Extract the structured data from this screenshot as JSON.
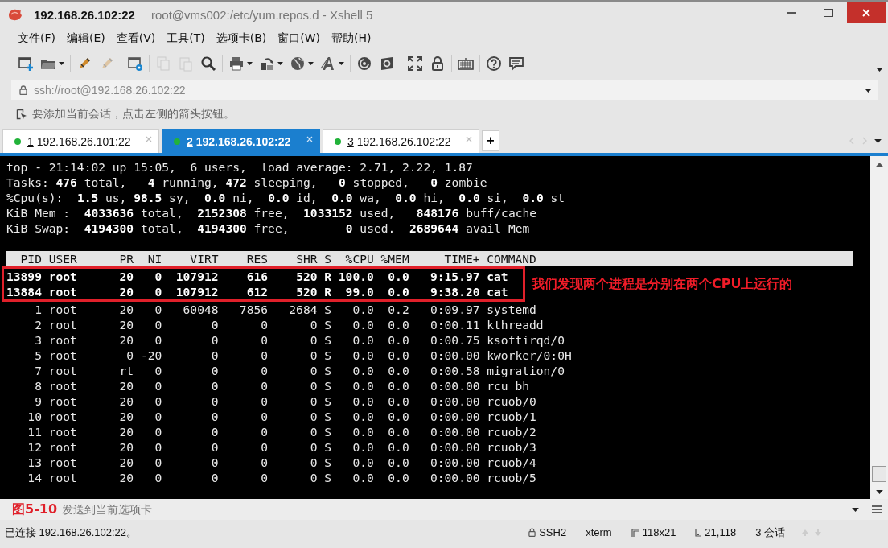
{
  "window": {
    "title_host": "192.168.26.102:22",
    "title_path": "root@vms002:/etc/yum.repos.d - Xshell 5"
  },
  "menu": [
    "文件(F)",
    "编辑(E)",
    "查看(V)",
    "工具(T)",
    "选项卡(B)",
    "窗口(W)",
    "帮助(H)"
  ],
  "toolbar": [
    {
      "kind": "new",
      "disabled": false,
      "dropdown": false
    },
    {
      "kind": "folder",
      "disabled": false,
      "dropdown": true
    },
    {
      "kind": "separator"
    },
    {
      "kind": "connect",
      "disabled": false,
      "dropdown": false
    },
    {
      "kind": "connect",
      "disabled": true,
      "dropdown": false
    },
    {
      "kind": "separator"
    },
    {
      "kind": "properties",
      "disabled": false,
      "dropdown": false
    },
    {
      "kind": "separator"
    },
    {
      "kind": "copy",
      "disabled": true,
      "dropdown": false
    },
    {
      "kind": "paste",
      "disabled": true,
      "dropdown": false
    },
    {
      "kind": "search",
      "disabled": false,
      "dropdown": false
    },
    {
      "kind": "separator"
    },
    {
      "kind": "print",
      "disabled": false,
      "dropdown": true
    },
    {
      "kind": "transfer",
      "disabled": false,
      "dropdown": true
    },
    {
      "kind": "globe",
      "disabled": false,
      "dropdown": true
    },
    {
      "kind": "font",
      "disabled": false,
      "dropdown": true
    },
    {
      "kind": "separator"
    },
    {
      "kind": "shell",
      "disabled": false,
      "dropdown": false
    },
    {
      "kind": "ftp",
      "disabled": false,
      "dropdown": false
    },
    {
      "kind": "separator"
    },
    {
      "kind": "fullscreen",
      "disabled": false,
      "dropdown": false
    },
    {
      "kind": "lock",
      "disabled": false,
      "dropdown": false
    },
    {
      "kind": "separator"
    },
    {
      "kind": "keyboard",
      "disabled": false,
      "dropdown": false
    },
    {
      "kind": "separator"
    },
    {
      "kind": "help",
      "disabled": false,
      "dropdown": false
    },
    {
      "kind": "chat",
      "disabled": false,
      "dropdown": false
    }
  ],
  "address": {
    "value": "ssh://root@192.168.26.102:22"
  },
  "hint": {
    "text": "要添加当前会话，点击左侧的箭头按钮。"
  },
  "tabs": [
    {
      "number": "1",
      "label": "192.168.26.101:22",
      "selected": false
    },
    {
      "number": "2",
      "label": "192.168.26.102:22",
      "selected": true
    },
    {
      "number": "3",
      "label": "192.168.26.102:22",
      "selected": false
    }
  ],
  "add_tab": "+",
  "terminal": {
    "summary_lines": [
      "top - 21:14:02 up 15:05,  6 users,  load average: 2.71, 2.22, 1.87",
      "Tasks: **476** total,   **4** running, **472** sleeping,   **0** stopped,   **0** zombie",
      "%Cpu(s):  **1.5** us, **98.5** sy,  **0.0** ni,  **0.0** id,  **0.0** wa,  **0.0** hi,  **0.0** si,  **0.0** st",
      "KiB Mem :  **4033636** total,  **2152308** free,  **1033152** used,   **848176** buff/cache",
      "KiB Swap:  **4194300** total,  **4194300** free,        **0** used.  **2689644** avail Mem"
    ],
    "columns": [
      "PID",
      "USER",
      "PR",
      "NI",
      "VIRT",
      "RES",
      "SHR",
      "S",
      "%CPU",
      "%MEM",
      "TIME+",
      "COMMAND"
    ],
    "rows": [
      {
        "bold": true,
        "boxed": true,
        "cells": [
          "13899",
          "root",
          "20",
          "0",
          "107912",
          "616",
          "520",
          "R",
          "100.0",
          "0.0",
          "9:15.97",
          "cat"
        ]
      },
      {
        "bold": true,
        "boxed": true,
        "cells": [
          "13884",
          "root",
          "20",
          "0",
          "107912",
          "612",
          "520",
          "R",
          "99.0",
          "0.0",
          "9:38.20",
          "cat"
        ]
      },
      {
        "bold": false,
        "boxed": false,
        "cells": [
          "1",
          "root",
          "20",
          "0",
          "60048",
          "7856",
          "2684",
          "S",
          "0.0",
          "0.2",
          "0:09.97",
          "systemd"
        ]
      },
      {
        "bold": false,
        "boxed": false,
        "cells": [
          "2",
          "root",
          "20",
          "0",
          "0",
          "0",
          "0",
          "S",
          "0.0",
          "0.0",
          "0:00.11",
          "kthreadd"
        ]
      },
      {
        "bold": false,
        "boxed": false,
        "cells": [
          "3",
          "root",
          "20",
          "0",
          "0",
          "0",
          "0",
          "S",
          "0.0",
          "0.0",
          "0:00.75",
          "ksoftirqd/0"
        ]
      },
      {
        "bold": false,
        "boxed": false,
        "cells": [
          "5",
          "root",
          "0",
          "-20",
          "0",
          "0",
          "0",
          "S",
          "0.0",
          "0.0",
          "0:00.00",
          "kworker/0:0H"
        ]
      },
      {
        "bold": false,
        "boxed": false,
        "cells": [
          "7",
          "root",
          "rt",
          "0",
          "0",
          "0",
          "0",
          "S",
          "0.0",
          "0.0",
          "0:00.58",
          "migration/0"
        ]
      },
      {
        "bold": false,
        "boxed": false,
        "cells": [
          "8",
          "root",
          "20",
          "0",
          "0",
          "0",
          "0",
          "S",
          "0.0",
          "0.0",
          "0:00.00",
          "rcu_bh"
        ]
      },
      {
        "bold": false,
        "boxed": false,
        "cells": [
          "9",
          "root",
          "20",
          "0",
          "0",
          "0",
          "0",
          "S",
          "0.0",
          "0.0",
          "0:00.00",
          "rcuob/0"
        ]
      },
      {
        "bold": false,
        "boxed": false,
        "cells": [
          "10",
          "root",
          "20",
          "0",
          "0",
          "0",
          "0",
          "S",
          "0.0",
          "0.0",
          "0:00.00",
          "rcuob/1"
        ]
      },
      {
        "bold": false,
        "boxed": false,
        "cells": [
          "11",
          "root",
          "20",
          "0",
          "0",
          "0",
          "0",
          "S",
          "0.0",
          "0.0",
          "0:00.00",
          "rcuob/2"
        ]
      },
      {
        "bold": false,
        "boxed": false,
        "cells": [
          "12",
          "root",
          "20",
          "0",
          "0",
          "0",
          "0",
          "S",
          "0.0",
          "0.0",
          "0:00.00",
          "rcuob/3"
        ]
      },
      {
        "bold": false,
        "boxed": false,
        "cells": [
          "13",
          "root",
          "20",
          "0",
          "0",
          "0",
          "0",
          "S",
          "0.0",
          "0.0",
          "0:00.00",
          "rcuob/4"
        ]
      },
      {
        "bold": false,
        "boxed": false,
        "cells": [
          "14",
          "root",
          "20",
          "0",
          "0",
          "0",
          "0",
          "S",
          "0.0",
          "0.0",
          "0:00.00",
          "rcuob/5"
        ]
      }
    ],
    "annotation": "我们发现两个进程是分别在两个CPU上运行的"
  },
  "input_bar": {
    "placeholder": "发送到当前选项卡"
  },
  "figure_label": "图5-10",
  "status_bar": {
    "connection": "已连接 192.168.26.102:22。",
    "protocol": "SSH2",
    "terminal_type": "xterm",
    "size": "118x21",
    "cursor": "21,118",
    "sessions": "3 会话"
  }
}
